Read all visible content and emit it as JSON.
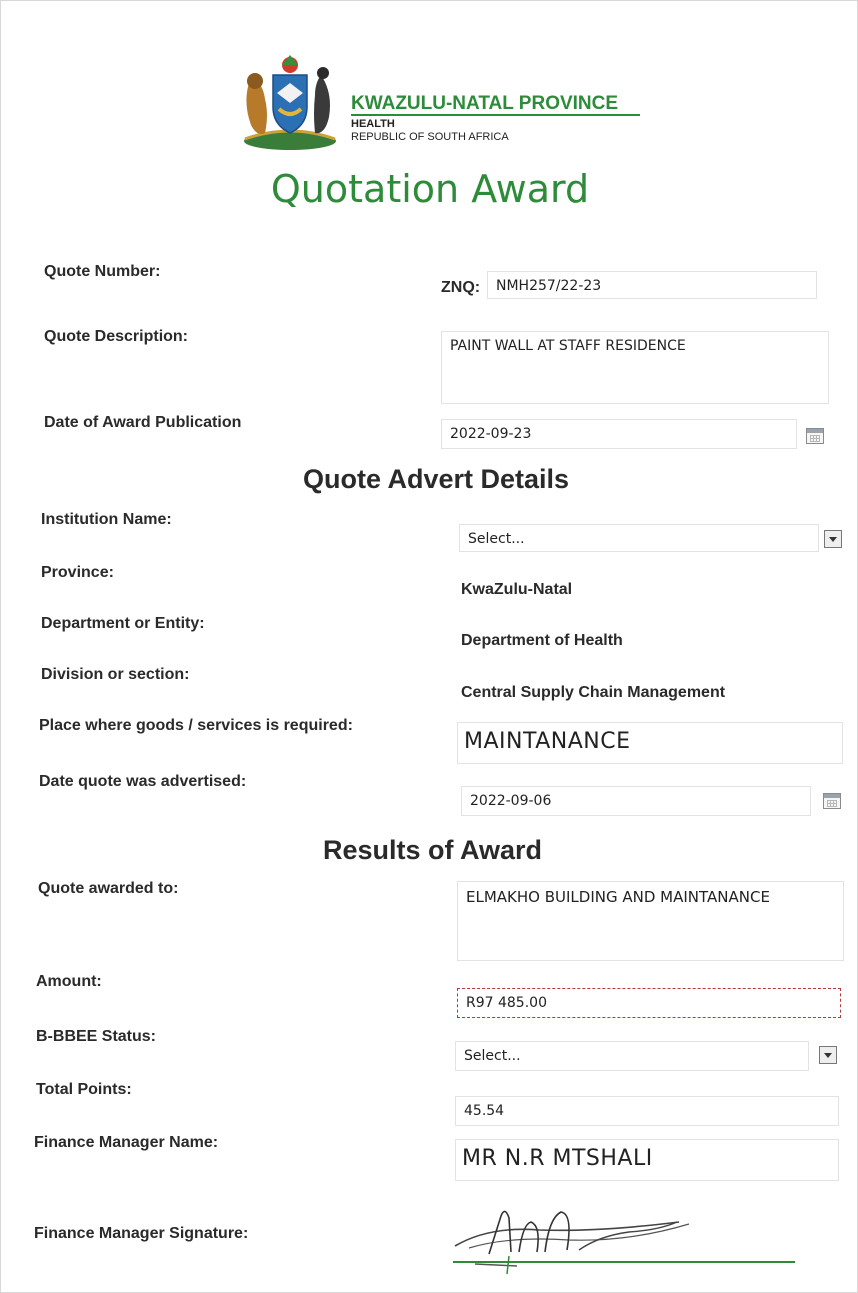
{
  "header": {
    "province": "KWAZULU-NATAL PROVINCE",
    "dept": "HEALTH",
    "republic": "REPUBLIC OF SOUTH AFRICA",
    "title": "Quotation Award",
    "brand_green": "#2e8b3a"
  },
  "quote": {
    "number_label": "Quote Number:",
    "number_prefix": "ZNQ:",
    "number_value": "NMH257/22-23",
    "description_label": "Quote Description:",
    "description_value": "PAINT WALL AT STAFF RESIDENCE",
    "award_date_label": "Date of Award Publication",
    "award_date_value": "2022-09-23"
  },
  "advert": {
    "heading": "Quote Advert Details",
    "institution_label": "Institution Name:",
    "institution_value": "Select...",
    "province_label": "Province:",
    "province_value": "KwaZulu-Natal",
    "department_label": "Department or Entity:",
    "department_value": "Department of Health",
    "division_label": "Division or section:",
    "division_value": "Central Supply Chain Management",
    "place_label": "Place where goods /  services is required:",
    "place_value": "MAINTANANCE",
    "advertised_label": "Date quote was advertised:",
    "advertised_value": "2022-09-06"
  },
  "results": {
    "heading": "Results of Award",
    "awarded_label": "Quote awarded to:",
    "awarded_value": "ELMAKHO BUILDING AND MAINTANANCE",
    "amount_label": "Amount:",
    "amount_value": "R97 485.00",
    "bbbee_label": "B-BBEE Status:",
    "bbbee_value": "Select...",
    "points_label": "Total Points:",
    "points_value": "45.54",
    "fm_name_label": "Finance Manager Name:",
    "fm_name_value": "MR N.R MTSHALI",
    "fm_signature_label": "Finance Manager Signature:"
  }
}
